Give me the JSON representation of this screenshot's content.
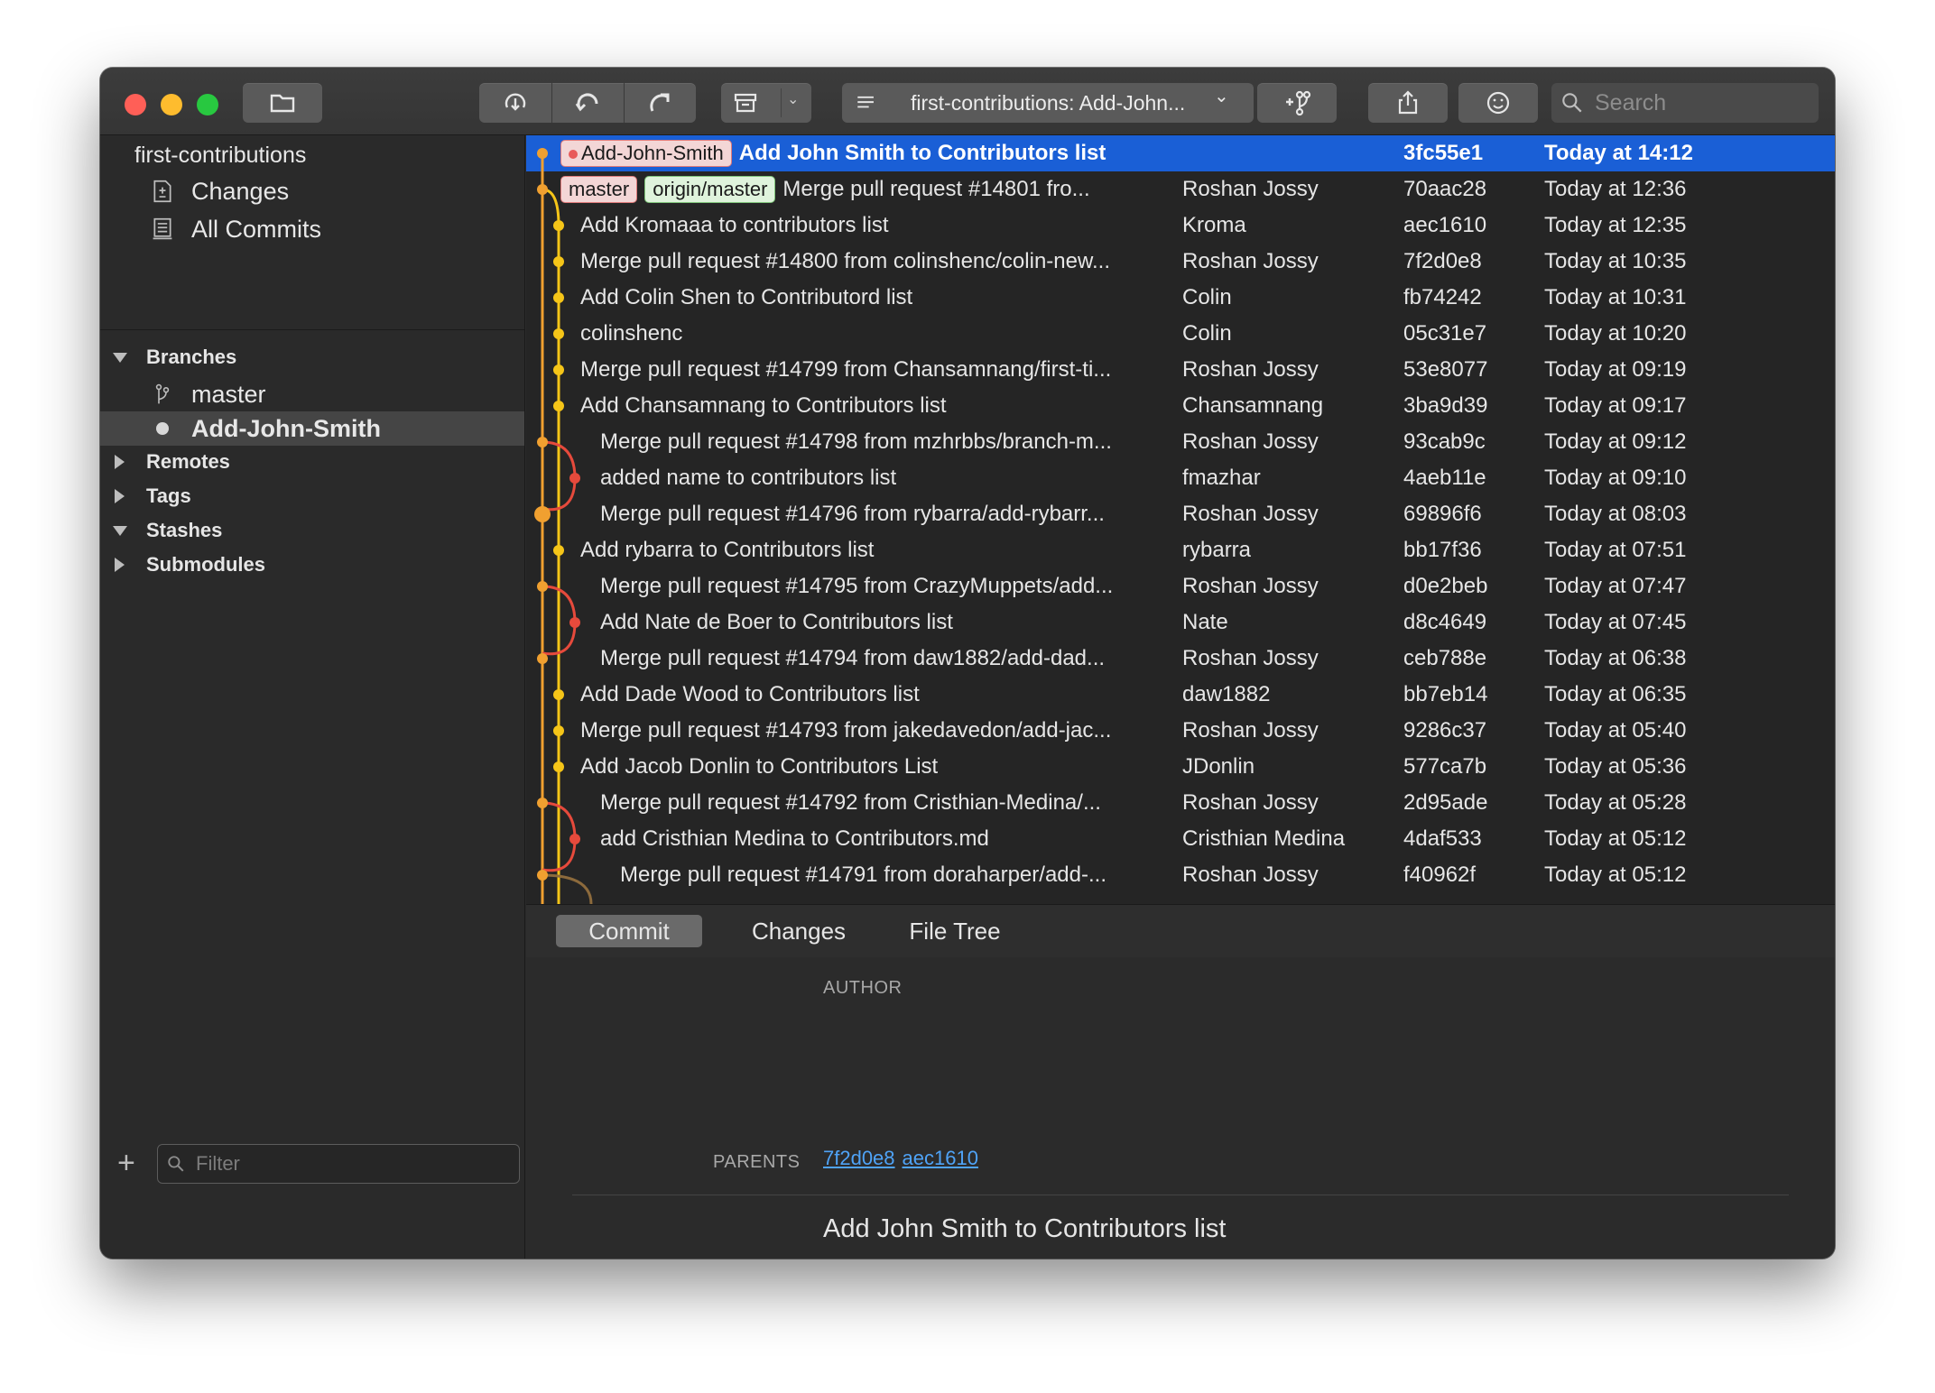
{
  "toolbar": {
    "branch_selector": "first-contributions: Add-John...",
    "search_placeholder": "Search"
  },
  "sidebar": {
    "repo_name": "first-contributions",
    "workspace": [
      {
        "label": "Changes",
        "icon": "changes-icon"
      },
      {
        "label": "All Commits",
        "icon": "commits-icon"
      }
    ],
    "branches_label": "Branches",
    "branches": [
      {
        "label": "master",
        "icon": "branch-icon"
      },
      {
        "label": "Add-John-Smith",
        "icon": "current-branch-dot-icon",
        "selected": true
      }
    ],
    "sections": [
      "Remotes",
      "Tags",
      "Stashes",
      "Submodules"
    ],
    "filter_placeholder": "Filter"
  },
  "commits": [
    {
      "tags": [
        {
          "text": "Add-John-Smith",
          "style": "red",
          "dot": true
        }
      ],
      "message": "Add John Smith to Contributors list",
      "author": "",
      "sha": "3fc55e1",
      "date": "Today at 14:12",
      "selected": true
    },
    {
      "tags": [
        {
          "text": "master",
          "style": "red"
        },
        {
          "text": "origin/master",
          "style": "green"
        }
      ],
      "message": "Merge pull request #14801 fro...",
      "author": "Roshan Jossy",
      "sha": "70aac28",
      "date": "Today at 12:36"
    },
    {
      "tags": [],
      "message": "Add Kromaaa to contributors list",
      "author": "Kroma",
      "sha": "aec1610",
      "date": "Today at 12:35"
    },
    {
      "tags": [],
      "message": "Merge pull request #14800 from colinshenc/colin-new...",
      "author": "Roshan Jossy",
      "sha": "7f2d0e8",
      "date": "Today at 10:35"
    },
    {
      "tags": [],
      "message": "Add Colin Shen to Contributord list",
      "author": "Colin",
      "sha": "fb74242",
      "date": "Today at 10:31"
    },
    {
      "tags": [],
      "message": "colinshenc",
      "author": "Colin",
      "sha": "05c31e7",
      "date": "Today at 10:20"
    },
    {
      "tags": [],
      "message": "Merge pull request #14799 from Chansamnang/first-ti...",
      "author": "Roshan Jossy",
      "sha": "53e8077",
      "date": "Today at 09:19"
    },
    {
      "tags": [],
      "message": "Add Chansamnang to Contributors list",
      "author": "Chansamnang",
      "sha": "3ba9d39",
      "date": "Today at 09:17"
    },
    {
      "tags": [],
      "message": "Merge pull request #14798 from mzhrbbs/branch-m...",
      "author": "Roshan Jossy",
      "sha": "93cab9c",
      "date": "Today at 09:12"
    },
    {
      "tags": [],
      "message": "added name to contributors list",
      "author": "fmazhar",
      "sha": "4aeb11e",
      "date": "Today at 09:10"
    },
    {
      "tags": [],
      "message": "Merge pull request #14796 from rybarra/add-rybarr...",
      "author": "Roshan Jossy",
      "sha": "69896f6",
      "date": "Today at 08:03"
    },
    {
      "tags": [],
      "message": "Add rybarra to Contributors list",
      "author": "rybarra",
      "sha": "bb17f36",
      "date": "Today at 07:51"
    },
    {
      "tags": [],
      "message": "Merge pull request #14795 from CrazyMuppets/add...",
      "author": "Roshan Jossy",
      "sha": "d0e2beb",
      "date": "Today at 07:47"
    },
    {
      "tags": [],
      "message": "Add Nate de Boer to Contributors list",
      "author": "Nate",
      "sha": "d8c4649",
      "date": "Today at 07:45"
    },
    {
      "tags": [],
      "message": "Merge pull request #14794 from daw1882/add-dad...",
      "author": "Roshan Jossy",
      "sha": "ceb788e",
      "date": "Today at 06:38"
    },
    {
      "tags": [],
      "message": "Add Dade Wood to Contributors list",
      "author": "daw1882",
      "sha": "bb7eb14",
      "date": "Today at 06:35"
    },
    {
      "tags": [],
      "message": "Merge pull request #14793 from jakedavedon/add-jac...",
      "author": "Roshan Jossy",
      "sha": "9286c37",
      "date": "Today at 05:40"
    },
    {
      "tags": [],
      "message": "Add Jacob Donlin to Contributors List",
      "author": "JDonlin",
      "sha": "577ca7b",
      "date": "Today at 05:36"
    },
    {
      "tags": [],
      "message": "Merge pull request #14792 from Cristhian-Medina/...",
      "author": "Roshan Jossy",
      "sha": "2d95ade",
      "date": "Today at 05:28"
    },
    {
      "tags": [],
      "message": "add Cristhian Medina to Contributors.md",
      "author": "Cristhian Medina",
      "sha": "4daf533",
      "date": "Today at 05:12"
    },
    {
      "tags": [],
      "message": "Merge pull request #14791 from doraharper/add-...",
      "author": "Roshan Jossy",
      "sha": "f40962f",
      "date": "Today at 05:12"
    }
  ],
  "detail_tabs": [
    {
      "label": "Commit",
      "active": true
    },
    {
      "label": "Changes"
    },
    {
      "label": "File Tree"
    }
  ],
  "detail": {
    "author_label": "AUTHOR",
    "parents_label": "PARENTS",
    "parents": [
      "7f2d0e8",
      "aec1610"
    ],
    "subject": "Add John Smith to Contributors list"
  },
  "colors": {
    "selection": "#1a5fd6",
    "graph_yellow": "#f5c518",
    "graph_orange": "#f0a030",
    "graph_red": "#e64a3c",
    "graph_brown": "#8c6a3c",
    "link": "#4fa3f7"
  }
}
